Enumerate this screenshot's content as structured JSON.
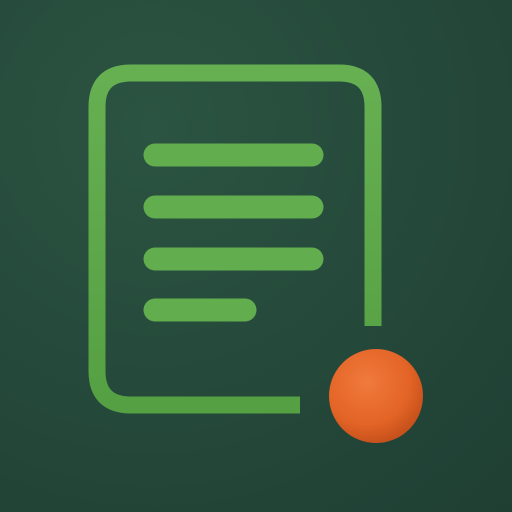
{
  "icon": {
    "semantic": "document-with-notification-icon",
    "colors": {
      "background": "#24483a",
      "document_stroke": "#5aa547",
      "text_lines": "#62ad4d",
      "notification_dot": "#e36426"
    },
    "document": {
      "text_line_count": 4
    },
    "notification": {
      "visible": true
    }
  }
}
